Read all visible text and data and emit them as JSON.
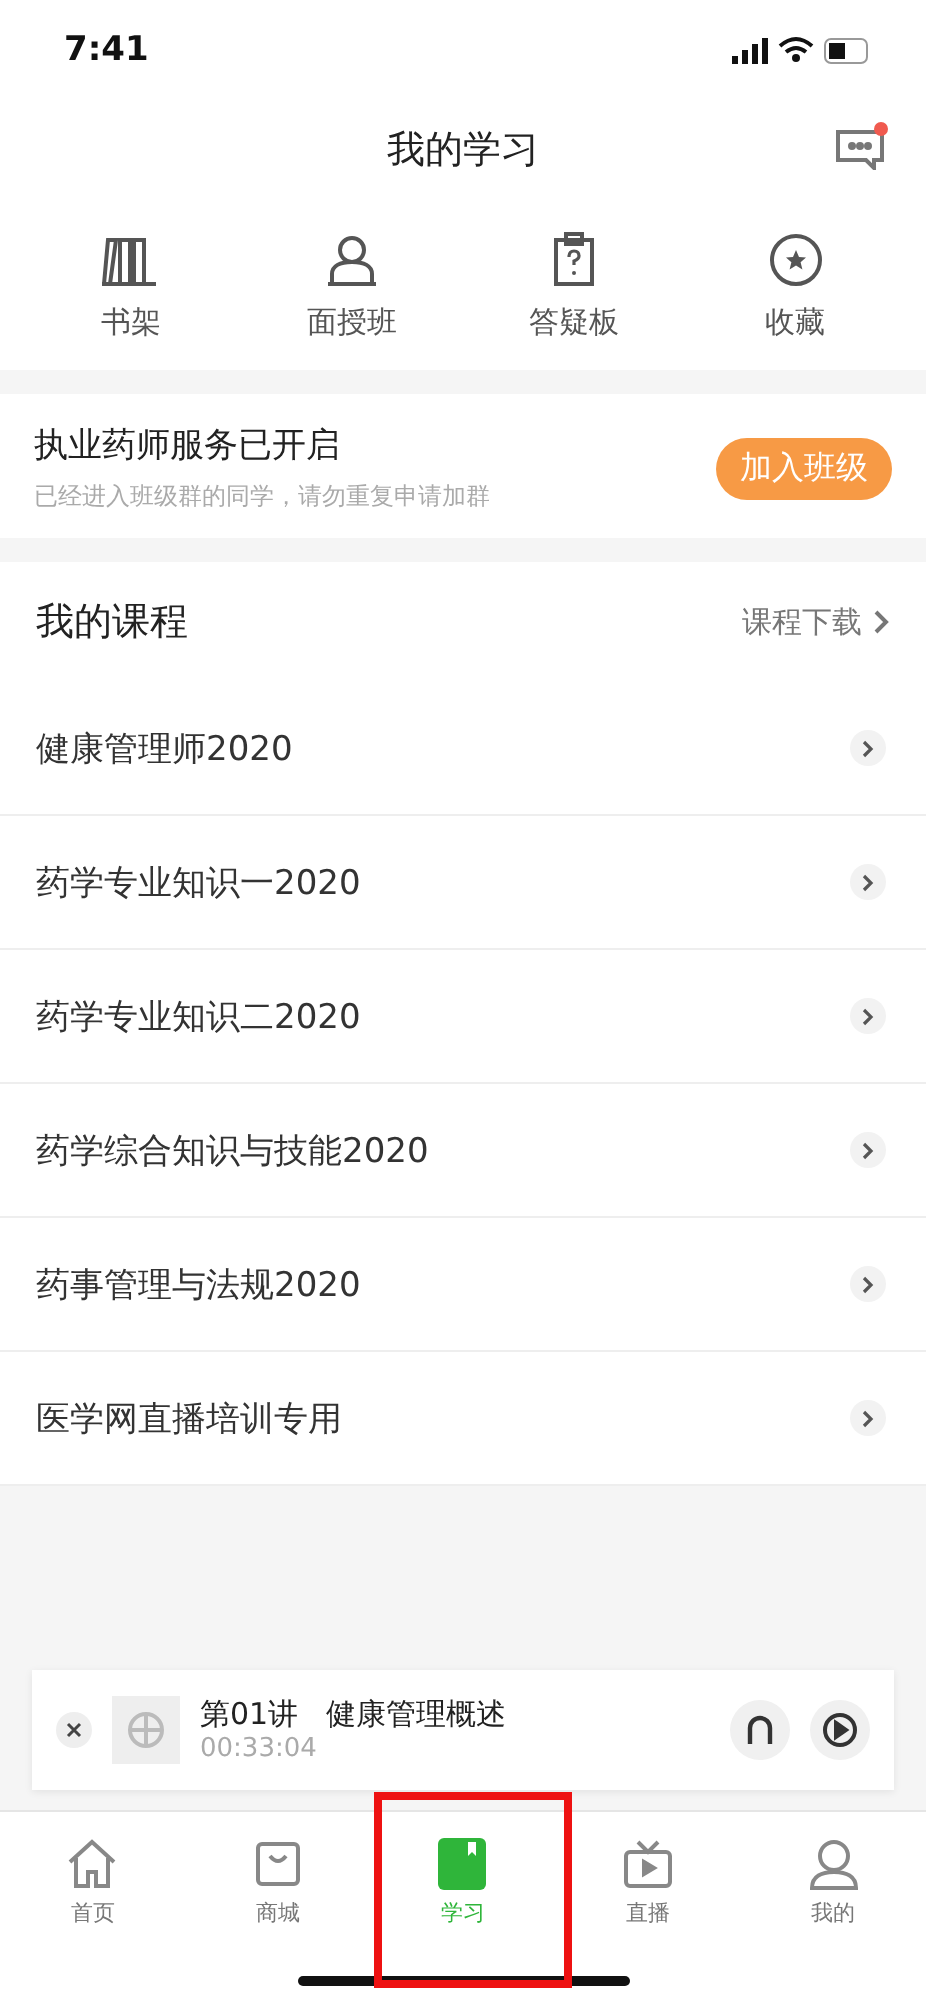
{
  "status_bar": {
    "time": "7:41"
  },
  "header": {
    "title": "我的学习",
    "message_unread": true
  },
  "shortcuts": [
    {
      "kind": "shelf",
      "label": "书架"
    },
    {
      "kind": "teacher",
      "label": "面授班"
    },
    {
      "kind": "question",
      "label": "答疑板"
    },
    {
      "kind": "favorite",
      "label": "收藏"
    }
  ],
  "notice": {
    "title": "执业药师服务已开启",
    "subtitle": "已经进入班级群的同学，请勿重复申请加群",
    "button": "加入班级"
  },
  "courses": {
    "title": "我的课程",
    "download": "课程下载",
    "items": [
      "健康管理师2020",
      "药学专业知识一2020",
      "药学专业知识二2020",
      "药学综合知识与技能2020",
      "药事管理与法规2020",
      "医学网直播培训专用"
    ]
  },
  "player": {
    "lesson": "第01讲",
    "title": "健康管理概述",
    "time": "00:33:04"
  },
  "tabs": [
    {
      "kind": "home",
      "label": "首页",
      "selected": false,
      "framed": false
    },
    {
      "kind": "shop",
      "label": "商城",
      "selected": false,
      "framed": false
    },
    {
      "kind": "study",
      "label": "学习",
      "selected": true,
      "framed": true
    },
    {
      "kind": "live",
      "label": "直播",
      "selected": false,
      "framed": false
    },
    {
      "kind": "mine",
      "label": "我的",
      "selected": false,
      "framed": false
    }
  ]
}
